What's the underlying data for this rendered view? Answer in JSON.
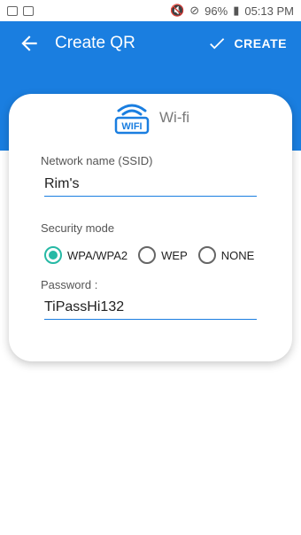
{
  "status_bar": {
    "battery": "96%",
    "time": "05:13 PM"
  },
  "appbar": {
    "title": "Create QR",
    "create_label": "CREATE"
  },
  "wifi": {
    "label": "Wi-fi",
    "icon_text": "WIFI"
  },
  "form": {
    "ssid_label": "Network name (SSID)",
    "ssid_value": "Rim's",
    "security_label": "Security mode",
    "security_options": [
      "WPA/WPA2",
      "WEP",
      "NONE"
    ],
    "security_selected": "WPA/WPA2",
    "password_label": "Password :",
    "password_value": "TiPassHi132"
  },
  "colors": {
    "primary": "#1a7ee0",
    "accent": "#26b9a5"
  }
}
